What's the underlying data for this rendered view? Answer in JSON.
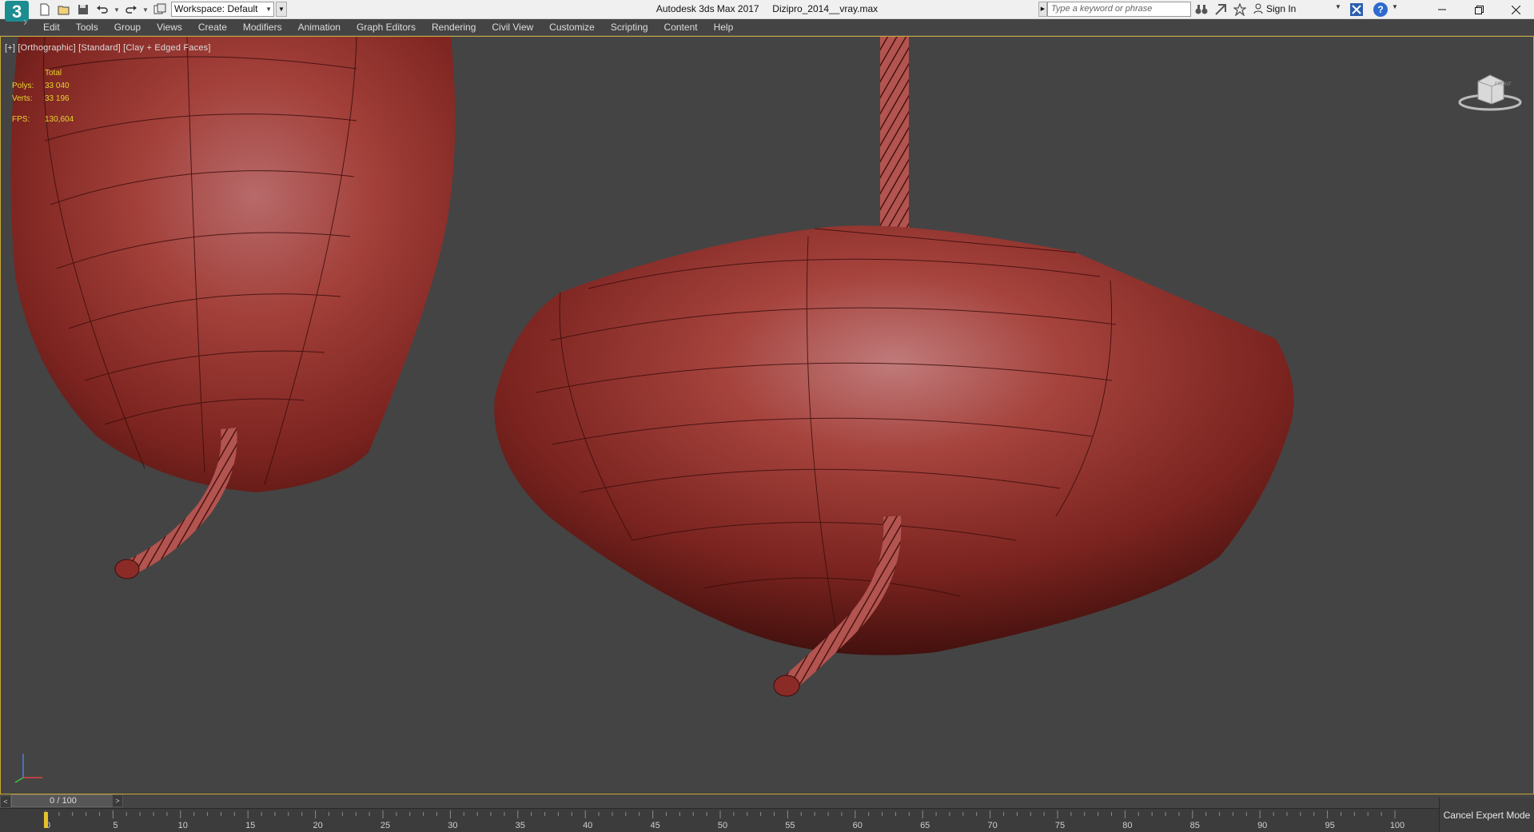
{
  "window": {
    "app_title": "Autodesk 3ds Max 2017",
    "file_name": "Dizipro_2014__vray.max",
    "minimize_icon": "minimize-icon",
    "restore_icon": "restore-icon",
    "close_icon": "close-icon"
  },
  "quick_access": {
    "workspace_label": "Workspace: Default",
    "icons": [
      "new-file-icon",
      "open-file-icon",
      "save-icon",
      "undo-icon",
      "redo-icon",
      "project-folder-icon"
    ]
  },
  "infocenter": {
    "search_placeholder": "Type a keyword or phrase",
    "sign_in": "Sign In",
    "help_glyph": "?"
  },
  "menu": {
    "items": [
      "Edit",
      "Tools",
      "Group",
      "Views",
      "Create",
      "Modifiers",
      "Animation",
      "Graph Editors",
      "Rendering",
      "Civil View",
      "Customize",
      "Scripting",
      "Content",
      "Help"
    ]
  },
  "viewport": {
    "label": "[+] [Orthographic] [Standard] [Clay + Edged Faces]",
    "stats": {
      "header": "Total",
      "polys_label": "Polys:",
      "polys_value": "33 040",
      "verts_label": "Verts:",
      "verts_value": "33 196",
      "fps_label": "FPS:",
      "fps_value": "130,604"
    },
    "viewcube_face": "FRONT",
    "border_color": "#c8a834",
    "model_color": "#a4342e"
  },
  "timeline": {
    "frame_display": "0 / 100",
    "prev_arrow": "<",
    "next_arrow": ">",
    "current_frame": 0,
    "tick_labels": [
      "0",
      "5",
      "10",
      "15",
      "20",
      "25",
      "30",
      "35",
      "40",
      "45",
      "50",
      "55",
      "60",
      "65",
      "70",
      "75",
      "80",
      "85",
      "90",
      "95",
      "100"
    ]
  },
  "status": {
    "cancel_expert_mode": "Cancel Expert Mode"
  }
}
